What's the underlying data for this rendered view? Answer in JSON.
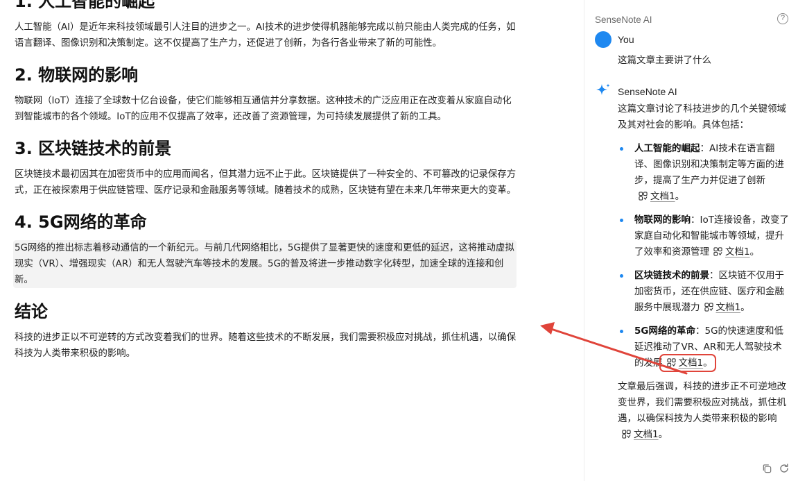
{
  "document": {
    "sections": [
      {
        "heading": "1. 人工智能的崛起",
        "body": "人工智能（AI）是近年来科技领域最引人注目的进步之一。AI技术的进步使得机器能够完成以前只能由人类完成的任务，如语言翻译、图像识别和决策制定。这不仅提高了生产力，还促进了创新，为各行各业带来了新的可能性。"
      },
      {
        "heading": "2. 物联网的影响",
        "body": "物联网（IoT）连接了全球数十亿台设备，使它们能够相互通信并分享数据。这种技术的广泛应用正在改变着从家庭自动化到智能城市的各个领域。IoT的应用不仅提高了效率，还改善了资源管理，为可持续发展提供了新的工具。"
      },
      {
        "heading": "3. 区块链技术的前景",
        "body": "区块链技术最初因其在加密货币中的应用而闻名，但其潜力远不止于此。区块链提供了一种安全的、不可篡改的记录保存方式，正在被探索用于供应链管理、医疗记录和金融服务等领域。随着技术的成熟，区块链有望在未来几年带来更大的变革。"
      },
      {
        "heading": "4. 5G网络的革命",
        "body": "5G网络的推出标志着移动通信的一个新纪元。与前几代网络相比，5G提供了显著更快的速度和更低的延迟，这将推动虚拟现实（VR）、增强现实（AR）和无人驾驶汽车等技术的发展。5G的普及将进一步推动数字化转型，加速全球的连接和创新。"
      },
      {
        "heading": "结论",
        "body": "科技的进步正以不可逆转的方式改变着我们的世界。随着这些技术的不断发展，我们需要积极应对挑战，抓住机遇，以确保科技为人类带来积极的影响。"
      }
    ]
  },
  "panel": {
    "title": "SenseNote AI",
    "help_label": "?",
    "user": {
      "name": "You",
      "message": "这篇文章主要讲了什么"
    },
    "ai": {
      "name": "SenseNote AI",
      "intro": "这篇文章讨论了科技进步的几个关键领域及其对社会的影响。具体包括：",
      "items": [
        {
          "title": "人工智能的崛起",
          "text": "：AI技术在语言翻译、图像识别和决策制定等方面的进步，提高了生产力并促进了创新",
          "ref": "文档1",
          "tail": "。"
        },
        {
          "title": "物联网的影响",
          "text": "：IoT连接设备，改变了家庭自动化和智能城市等领域，提升了效率和资源管理",
          "ref": "文档1",
          "tail": "。"
        },
        {
          "title": "区块链技术的前景",
          "text": "：区块链不仅用于加密货币，还在供应链、医疗和金融服务中展现潜力",
          "ref": "文档1",
          "tail": "。"
        },
        {
          "title": "5G网络的革命",
          "text": "：5G的快速速度和低延迟推动了VR、AR和无人驾驶技术的发展",
          "ref": "文档1",
          "tail": "。"
        }
      ],
      "outro": "文章最后强调，科技的进步正不可逆地改变世界，我们需要积极应对挑战，抓住机遇，以确保科技为人类带来积极的影响",
      "outro_ref": "文档1",
      "outro_tail": "。"
    }
  },
  "colors": {
    "accent": "#1e88f0",
    "annotation": "#e0443a",
    "highlight_bg": "#f3f3f3"
  },
  "icons": {
    "help": "help-icon",
    "sparkle": "sparkle-icon",
    "reference": "reference-icon",
    "copy": "copy-icon",
    "refresh": "refresh-icon"
  }
}
